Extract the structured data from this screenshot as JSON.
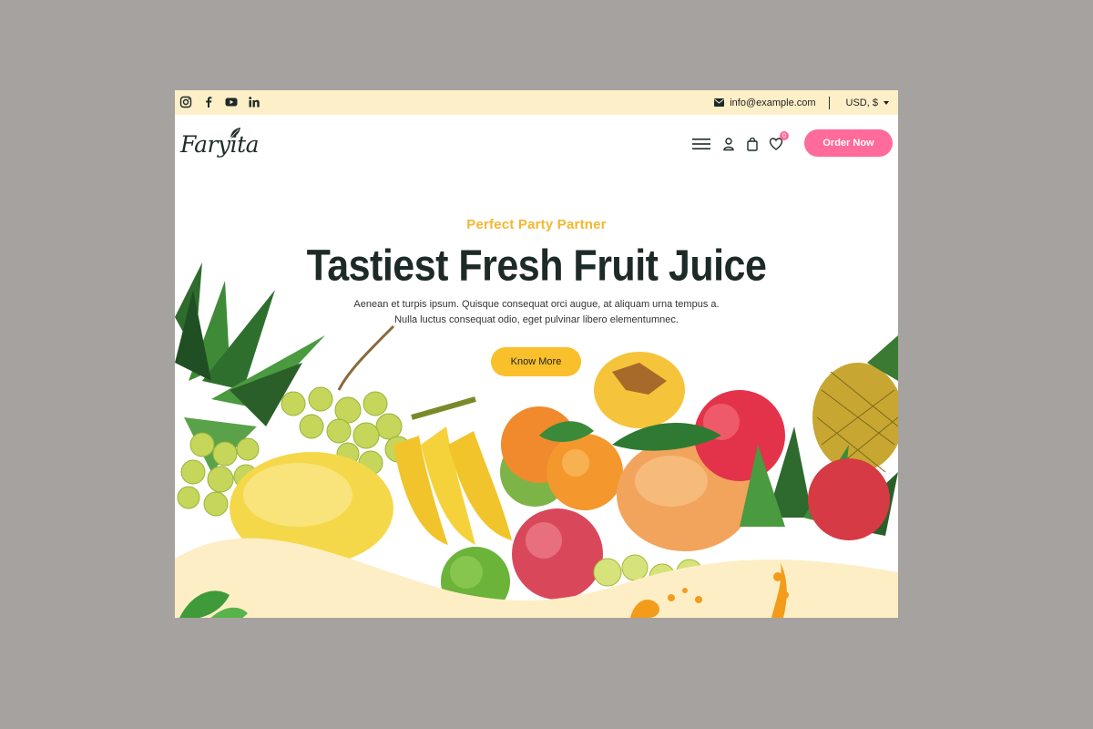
{
  "topbar": {
    "social": [
      "instagram-icon",
      "facebook-icon",
      "youtube-icon",
      "linkedin-icon"
    ],
    "email": "info@example.com",
    "currency": "USD, $"
  },
  "header": {
    "logo": "Faryita",
    "wishlist_count": "0",
    "order_button": "Order Now"
  },
  "hero": {
    "eyebrow": "Perfect Party Partner",
    "title": "Tastiest Fresh Fruit Juice",
    "description_line1": "Aenean et turpis ipsum. Quisque consequat orci augue, at aliquam urna tempus a.",
    "description_line2": "Nulla luctus consequat odio, eget pulvinar libero elementumnec.",
    "cta": "Know More"
  },
  "colors": {
    "topbar_bg": "#fdefc8",
    "accent_pink": "#ff6b9a",
    "accent_yellow": "#f9c02b",
    "heading": "#1d2a27"
  }
}
